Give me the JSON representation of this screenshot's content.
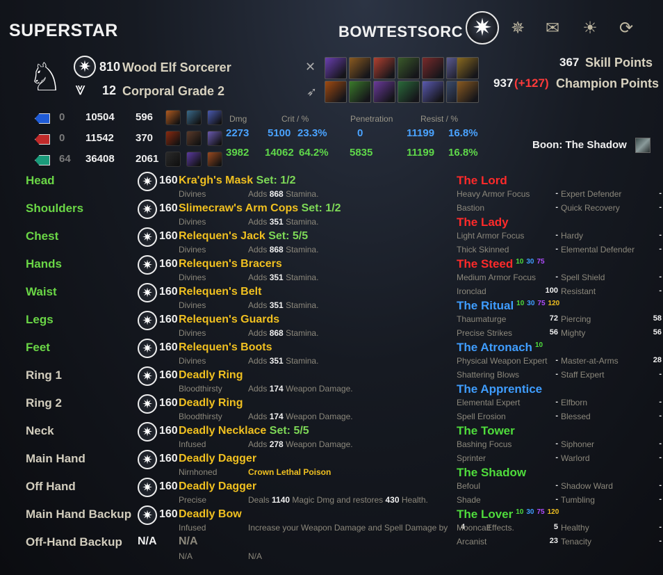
{
  "header": {
    "title": "SUPERSTAR",
    "character_name": "BOWTESTSORC",
    "tabs": [
      {
        "name": "champion-tab-icon",
        "glyph": "✷"
      },
      {
        "name": "skills-tab-icon",
        "glyph": "✵"
      },
      {
        "name": "scroll-tab-icon",
        "glyph": "✉"
      },
      {
        "name": "sun-tab-icon",
        "glyph": "☀"
      },
      {
        "name": "swirl-tab-icon",
        "glyph": "⟳"
      }
    ]
  },
  "character": {
    "cp_level": "810",
    "race_class": "Wood Elf Sorcerer",
    "rank": "12",
    "rank_title": "Corporal Grade 2",
    "crest_glyph": "♘"
  },
  "points": {
    "skill_points": "367",
    "skill_points_label": "Skill Points",
    "champion_points": "937",
    "champion_bonus": "(+127)",
    "champion_label": "Champion Points"
  },
  "skill_bars": {
    "bar1_colors": [
      "#6a3fb0",
      "#8a5a20",
      "#b04030",
      "#3a5a2a",
      "#7a2a2a",
      "#5a5a90",
      "#8a6a20"
    ],
    "bar2_colors": [
      "#a04a10",
      "#3a7a2a",
      "#6a3a9a",
      "#2a6a3a",
      "#5a5ab0",
      "#3a4a6a",
      "#8a5a20"
    ]
  },
  "resources": {
    "rows": [
      {
        "color": "#1f5bd6",
        "cp": "0",
        "max": "10504",
        "regen": "596"
      },
      {
        "color": "#c02a2a",
        "cp": "0",
        "max": "11542",
        "regen": "370"
      },
      {
        "color": "#1a9a7a",
        "cp": "64",
        "max": "36408",
        "regen": "2061"
      }
    ]
  },
  "stats": {
    "headers": {
      "dmg": "Dmg",
      "crit": "Crit / %",
      "pen": "Penetration",
      "resist": "Resist / %"
    },
    "spell": {
      "dmg": "2273",
      "crit": "5100",
      "crit_pct": "23.3%",
      "pen": "0",
      "resist": "11199",
      "resist_pct": "16.8%"
    },
    "weapon": {
      "dmg": "3982",
      "crit": "14062",
      "crit_pct": "64.2%",
      "pen": "5835",
      "resist": "11199",
      "resist_pct": "16.8%"
    }
  },
  "boon": "Boon: The Shadow",
  "gear": [
    {
      "slot": "Head",
      "color": "g",
      "lvl": "160",
      "item": "Kra'gh's Mask",
      "set": "Set: 1/2",
      "trait": "Divines",
      "pre": "Adds",
      "val": "868",
      "post": "Stamina."
    },
    {
      "slot": "Shoulders",
      "color": "g",
      "lvl": "160",
      "item": "Slimecraw's Arm Cops",
      "set": "Set: 1/2",
      "trait": "Divines",
      "pre": "Adds",
      "val": "351",
      "post": "Stamina."
    },
    {
      "slot": "Chest",
      "color": "g",
      "lvl": "160",
      "item": "Relequen's Jack",
      "set": "Set: 5/5",
      "trait": "Divines",
      "pre": "Adds",
      "val": "868",
      "post": "Stamina."
    },
    {
      "slot": "Hands",
      "color": "g",
      "lvl": "160",
      "item": "Relequen's Bracers",
      "set": "",
      "trait": "Divines",
      "pre": "Adds",
      "val": "351",
      "post": "Stamina."
    },
    {
      "slot": "Waist",
      "color": "g",
      "lvl": "160",
      "item": "Relequen's Belt",
      "set": "",
      "trait": "Divines",
      "pre": "Adds",
      "val": "351",
      "post": "Stamina."
    },
    {
      "slot": "Legs",
      "color": "g",
      "lvl": "160",
      "item": "Relequen's Guards",
      "set": "",
      "trait": "Divines",
      "pre": "Adds",
      "val": "868",
      "post": "Stamina."
    },
    {
      "slot": "Feet",
      "color": "g",
      "lvl": "160",
      "item": "Relequen's Boots",
      "set": "",
      "trait": "Divines",
      "pre": "Adds",
      "val": "351",
      "post": "Stamina."
    },
    {
      "slot": "Ring 1",
      "color": "w",
      "lvl": "160",
      "item": "Deadly Ring",
      "set": "",
      "trait": "Bloodthirsty",
      "pre": "Adds",
      "val": "174",
      "post": "Weapon Damage."
    },
    {
      "slot": "Ring 2",
      "color": "w",
      "lvl": "160",
      "item": "Deadly Ring",
      "set": "",
      "trait": "Bloodthirsty",
      "pre": "Adds",
      "val": "174",
      "post": "Weapon Damage."
    },
    {
      "slot": "Neck",
      "color": "w",
      "lvl": "160",
      "item": "Deadly Necklace",
      "set": "Set: 5/5",
      "trait": "Infused",
      "pre": "Adds",
      "val": "278",
      "post": "Weapon Damage."
    },
    {
      "slot": "Main Hand",
      "color": "w",
      "lvl": "160",
      "item": "Deadly Dagger",
      "set": "",
      "trait": "Nirnhoned",
      "pre": "",
      "val": "",
      "post": "",
      "poison": "Crown Lethal Poison"
    },
    {
      "slot": "Off Hand",
      "color": "w",
      "lvl": "160",
      "item": "Deadly Dagger",
      "set": "",
      "trait": "Precise",
      "pre": "Deals",
      "val": "1140",
      "post": "Magic Dmg and restores",
      "val2": "430",
      "post2": "Health."
    },
    {
      "slot": "Main Hand Backup",
      "color": "w",
      "lvl": "160",
      "item": "Deadly Bow",
      "set": "",
      "trait": "Infused",
      "pre": "Increase your Weapon Damage and Spell Damage by",
      "val": "",
      "post": "",
      "overlap": "4",
      "overlap2": "Effects."
    }
  ],
  "offhand_backup": {
    "slot": "Off-Hand Backup",
    "lvl": "N/A",
    "item": "N/A",
    "trait": "N/A",
    "desc": "N/A"
  },
  "constellations": [
    {
      "name": "The Lord",
      "color": "c-red",
      "tiers": [],
      "stars": [
        [
          "Heavy Armor Focus",
          "-",
          "Expert Defender",
          "-"
        ],
        [
          "Bastion",
          "-",
          "Quick Recovery",
          "-"
        ]
      ]
    },
    {
      "name": "The Lady",
      "color": "c-red",
      "tiers": [],
      "stars": [
        [
          "Light Armor Focus",
          "-",
          "Hardy",
          "-"
        ],
        [
          "Thick Skinned",
          "-",
          "Elemental Defender",
          "-"
        ]
      ]
    },
    {
      "name": "The Steed",
      "color": "c-red",
      "tiers": [
        "10",
        "30",
        "75"
      ],
      "stars": [
        [
          "Medium Armor Focus",
          "-",
          "Spell Shield",
          "-"
        ],
        [
          "Ironclad",
          "100",
          "Resistant",
          "-"
        ]
      ]
    },
    {
      "name": "The Ritual",
      "color": "c-blue",
      "tiers": [
        "10",
        "30",
        "75",
        "120"
      ],
      "stars": [
        [
          "Thaumaturge",
          "72",
          "Piercing",
          "58"
        ],
        [
          "Precise Strikes",
          "56",
          "Mighty",
          "56"
        ]
      ]
    },
    {
      "name": "The Atronach",
      "color": "c-blue",
      "tiers": [
        "10"
      ],
      "stars": [
        [
          "Physical Weapon Expert",
          "-",
          "Master-at-Arms",
          "28"
        ],
        [
          "Shattering Blows",
          "-",
          "Staff Expert",
          "-"
        ]
      ]
    },
    {
      "name": "The Apprentice",
      "color": "c-blue",
      "tiers": [],
      "stars": [
        [
          "Elemental Expert",
          "-",
          "Elfborn",
          "-"
        ],
        [
          "Spell Erosion",
          "-",
          "Blessed",
          "-"
        ]
      ]
    },
    {
      "name": "The Tower",
      "color": "c-green",
      "tiers": [],
      "stars": [
        [
          "Bashing Focus",
          "-",
          "Siphoner",
          "-"
        ],
        [
          "Sprinter",
          "-",
          "Warlord",
          "-"
        ]
      ]
    },
    {
      "name": "The Shadow",
      "color": "c-green",
      "tiers": [],
      "stars": [
        [
          "Befoul",
          "-",
          "Shadow Ward",
          "-"
        ],
        [
          "Shade",
          "-",
          "Tumbling",
          "-"
        ]
      ]
    },
    {
      "name": "The Lover",
      "color": "c-green",
      "tiers": [
        "10",
        "30",
        "75",
        "120"
      ],
      "stars": [
        [
          "Mooncalf",
          "5",
          "Healthy",
          "-"
        ],
        [
          "Arcanist",
          "23",
          "Tenacity",
          "-"
        ]
      ]
    }
  ]
}
